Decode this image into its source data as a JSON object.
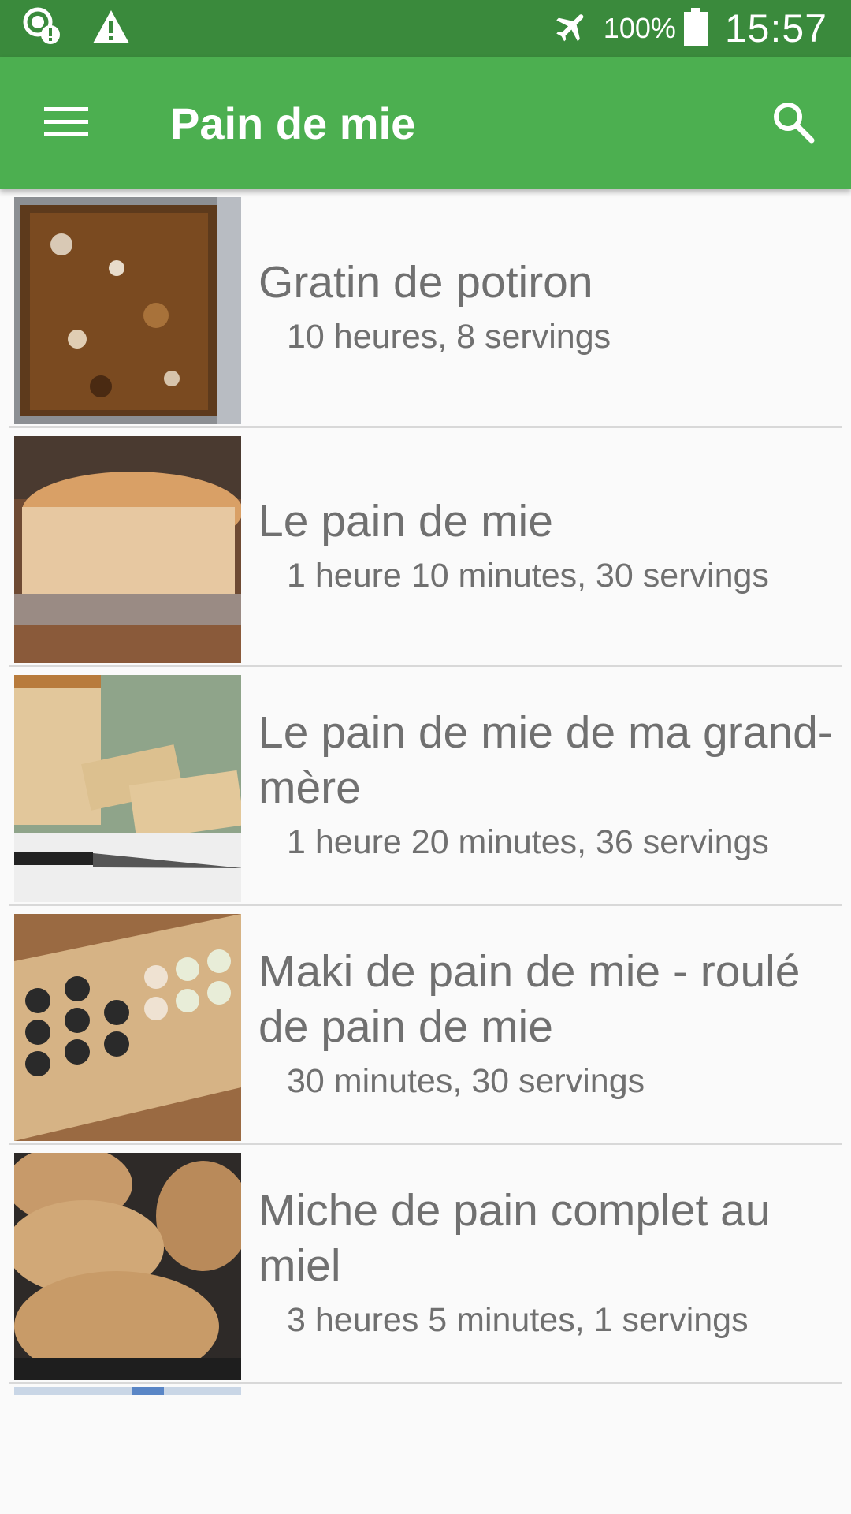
{
  "status_bar": {
    "battery_percent": "100%",
    "time": "15:57",
    "icons": [
      "data-warning-icon",
      "warning-icon",
      "airplane-mode-icon",
      "battery-icon"
    ]
  },
  "app_bar": {
    "title": "Pain de mie",
    "icons": [
      "menu-icon",
      "search-icon"
    ]
  },
  "recipes": [
    {
      "title": "Gratin de potiron",
      "subtitle": "10 heures, 8 servings"
    },
    {
      "title": "Le pain de mie",
      "subtitle": "1 heure 10 minutes, 30 servings"
    },
    {
      "title": "Le pain de mie de ma grand-mère",
      "subtitle": "1 heure 20 minutes, 36 servings"
    },
    {
      "title": "Maki de pain de mie - roulé de pain de mie",
      "subtitle": "30 minutes, 30 servings"
    },
    {
      "title": "Miche de pain complet au miel",
      "subtitle": "3 heures 5 minutes, 1 servings"
    }
  ],
  "colors": {
    "status_bar": "#3a8a3c",
    "app_bar": "#4caf50",
    "list_bg": "#fafafa",
    "text": "#707070",
    "divider": "#d8d8d8"
  }
}
